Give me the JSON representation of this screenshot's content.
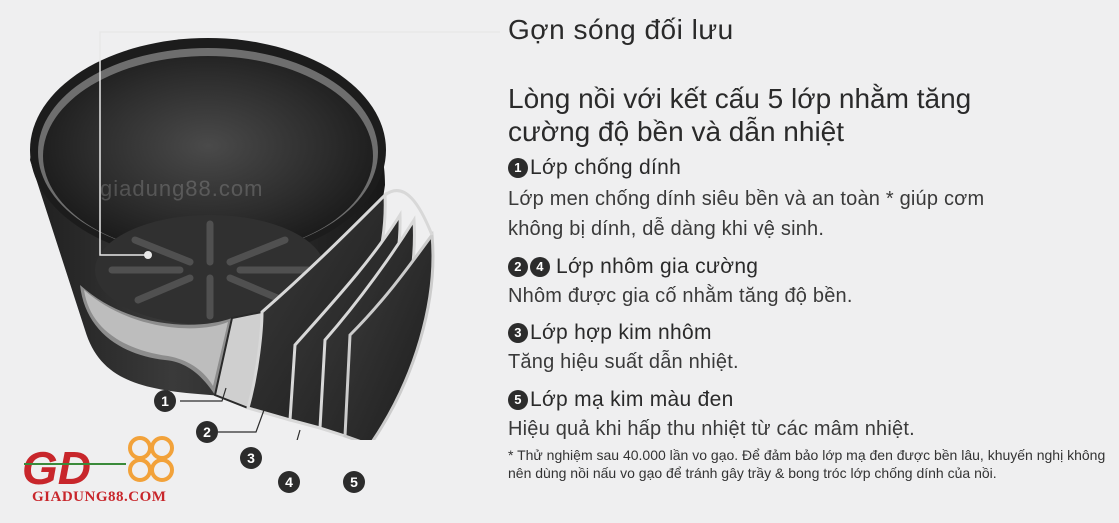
{
  "labels": {
    "wave": "Gợn sóng đối lưu",
    "main_line1": "Lòng nồi với kết cấu 5 lớp nhằm tăng",
    "main_line2": "cường độ bền và dẫn nhiệt"
  },
  "layers": [
    {
      "nums": [
        "1"
      ],
      "title": "Lớp chống dính",
      "desc": [
        "Lớp men chống dính siêu bền và an toàn * giúp cơm",
        "không bị dính, dễ dàng khi vệ sinh."
      ]
    },
    {
      "nums": [
        "2",
        "4"
      ],
      "title": "Lớp nhôm gia cường",
      "desc": [
        "Nhôm được gia cố nhằm tăng độ bền."
      ]
    },
    {
      "nums": [
        "3"
      ],
      "title": "Lớp hợp kim nhôm",
      "desc": [
        "Tăng hiệu suất dẫn nhiệt."
      ]
    },
    {
      "nums": [
        "5"
      ],
      "title": "Lớp mạ kim màu đen",
      "desc": [
        "Hiệu quả khi hấp thu nhiệt từ các mâm nhiệt."
      ]
    }
  ],
  "footnote": "* Thử nghiệm sau 40.000 lần vo gạo. Để đảm bảo lớp mạ đen được bền lâu, khuyến nghị không nên dùng nồi nấu vo gạo để tránh gây trầy & bong tróc lớp chống dính của nồi.",
  "diagram_markers": [
    "1",
    "2",
    "3",
    "4",
    "5"
  ],
  "watermark": "giadung88.com",
  "logo": {
    "mark": "GD",
    "sub": "GIADUNG88.COM",
    "accent": "#c8262b",
    "ring": "#f2a23a"
  },
  "colors": {
    "background": "#efeff0",
    "pot": "#2b2b2b",
    "text": "#2a2a2a"
  }
}
